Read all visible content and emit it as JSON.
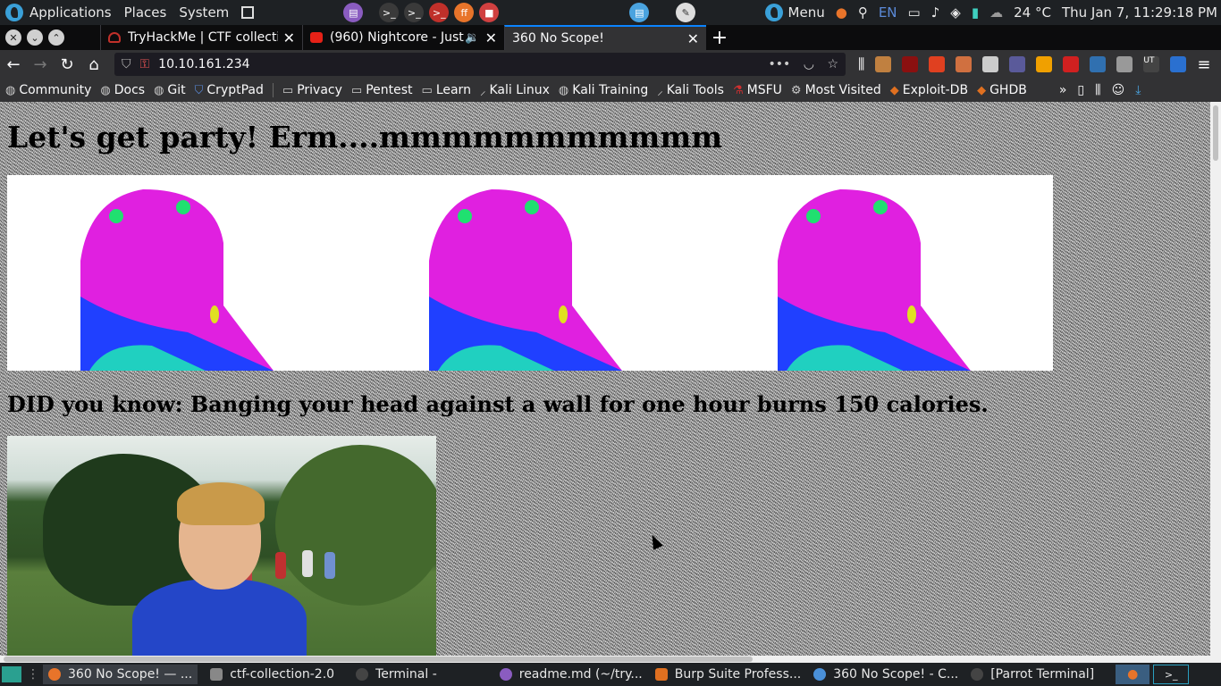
{
  "top_panel": {
    "applications": "Applications",
    "places": "Places",
    "system": "System",
    "menu": "Menu",
    "lang": "EN",
    "temperature": "24 °C",
    "clock": "Thu Jan  7, 11:29:18 PM"
  },
  "tabs": [
    {
      "title": "TryHackMe | CTF collecti",
      "icon": "tryhackme-icon"
    },
    {
      "title": "(960) Nightcore - Just",
      "icon": "youtube-icon"
    },
    {
      "title": "360 No Scope!",
      "icon": "page-icon"
    }
  ],
  "navbar": {
    "url": "10.10.161.234"
  },
  "bookmarks": [
    {
      "label": "Community",
      "icon": "globe-icon"
    },
    {
      "label": "Docs",
      "icon": "globe-icon"
    },
    {
      "label": "Git",
      "icon": "globe-icon"
    },
    {
      "label": "CryptPad",
      "icon": "shield-icon"
    },
    {
      "label": "Privacy",
      "icon": "folder-icon"
    },
    {
      "label": "Pentest",
      "icon": "folder-icon"
    },
    {
      "label": "Learn",
      "icon": "folder-icon"
    },
    {
      "label": "Kali Linux",
      "icon": "kali-icon"
    },
    {
      "label": "Kali Training",
      "icon": "globe-icon"
    },
    {
      "label": "Kali Tools",
      "icon": "kali-icon"
    },
    {
      "label": "MSFU",
      "icon": "msfu-icon"
    },
    {
      "label": "Most Visited",
      "icon": "gear-icon"
    },
    {
      "label": "Exploit-DB",
      "icon": "exploitdb-icon"
    },
    {
      "label": "GHDB",
      "icon": "exploitdb-icon"
    }
  ],
  "page": {
    "heading": "Let's get party! Erm....mmmmmmmmmmm",
    "subheading": "DID you know: Banging your head against a wall for one hour burns 150 calories."
  },
  "taskbar": [
    {
      "label": "360 No Scope! — ...",
      "icon": "firefox-icon"
    },
    {
      "label": "ctf-collection-2.0",
      "icon": "folder-icon"
    },
    {
      "label": "Terminal -",
      "icon": "terminal-icon"
    },
    {
      "label": "readme.md (~/try...",
      "icon": "editor-icon"
    },
    {
      "label": "Burp Suite Profess...",
      "icon": "burp-icon"
    },
    {
      "label": "360 No Scope! - C...",
      "icon": "chrome-icon"
    },
    {
      "label": "[Parrot Terminal]",
      "icon": "terminal-icon"
    }
  ],
  "colors": {
    "tab_accent": "#0a84ff",
    "frog_magenta": "#e020e0",
    "frog_blue": "#2040ff",
    "shirt_blue": "#2446c8"
  }
}
